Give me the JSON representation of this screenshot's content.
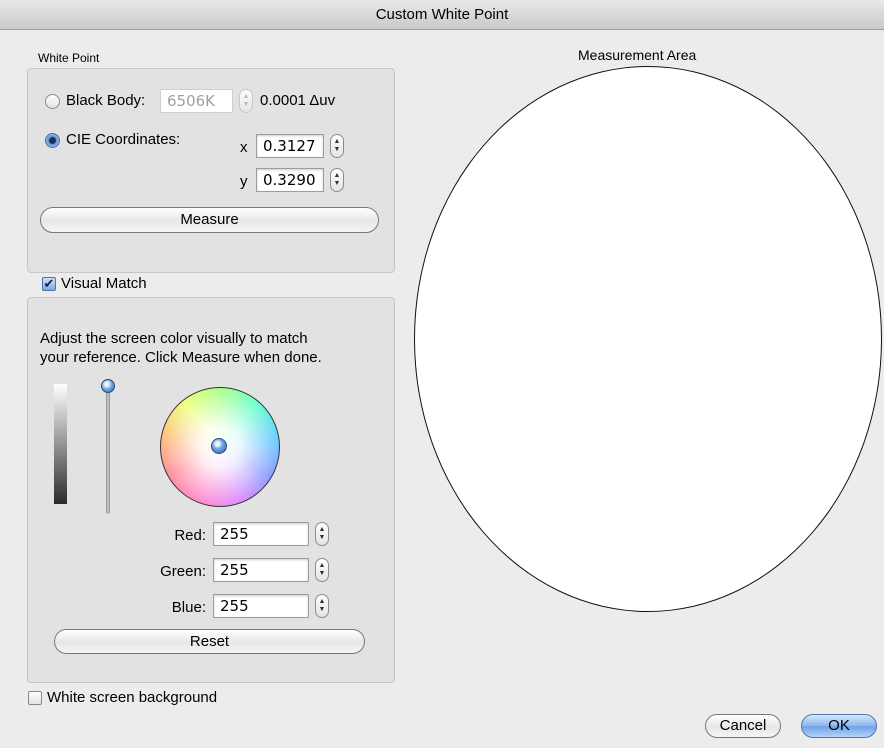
{
  "window": {
    "title": "Custom White Point"
  },
  "white_point": {
    "group_label": "White Point",
    "black_body": {
      "label": "Black Body:",
      "value": "6506K",
      "delta": "0.0001 Δuv",
      "selected": false
    },
    "cie": {
      "label": "CIE Coordinates:",
      "selected": true,
      "x_label": "x",
      "x_value": "0.3127",
      "y_label": "y",
      "y_value": "0.3290"
    },
    "measure_button": "Measure"
  },
  "visual_match": {
    "checkbox_label": "Visual Match",
    "checked": true,
    "instructions_line1": "Adjust the screen color visually to match",
    "instructions_line2": "your reference. Click Measure when done.",
    "brightness_level": 1.0,
    "red_label": "Red:",
    "red_value": "255",
    "green_label": "Green:",
    "green_value": "255",
    "blue_label": "Blue:",
    "blue_value": "255",
    "reset_button": "Reset"
  },
  "measurement": {
    "title": "Measurement Area"
  },
  "white_background": {
    "label": "White screen background",
    "checked": false
  },
  "buttons": {
    "cancel": "Cancel",
    "ok": "OK"
  },
  "icons": {
    "stepper": "up-down-arrows-icon",
    "checkmark": "checkmark-icon",
    "slider_knob": "slider-knob-icon",
    "color_picker": "color-picker-knob-icon"
  }
}
